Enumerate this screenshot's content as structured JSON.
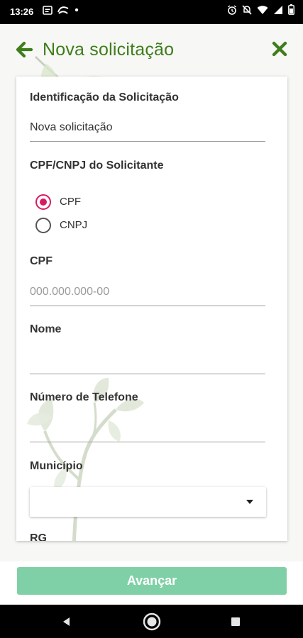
{
  "status_bar": {
    "time": "13:26",
    "left_icons": [
      "calendar-icon",
      "swirl-icon",
      "dot-icon"
    ],
    "right_icons": [
      "alarm-icon",
      "mute-icon",
      "wifi-icon",
      "signal-icon",
      "battery-icon"
    ]
  },
  "header": {
    "title": "Nova solicitação",
    "back_icon": "arrow-left-icon",
    "close_icon": "close-x-icon",
    "accent_color": "#3e7d1a"
  },
  "form": {
    "identificacao": {
      "label": "Identificação da Solicitação",
      "value": "Nova solicitação"
    },
    "cpf_cnpj": {
      "label": "CPF/CNPJ do Solicitante",
      "options": [
        {
          "label": "CPF",
          "checked": true
        },
        {
          "label": "CNPJ",
          "checked": false
        }
      ],
      "radio_color": "#d81b60"
    },
    "cpf": {
      "label": "CPF",
      "placeholder": "000.000.000-00",
      "value": ""
    },
    "nome": {
      "label": "Nome",
      "value": ""
    },
    "telefone": {
      "label": "Número de Telefone",
      "value": ""
    },
    "municipio": {
      "label": "Município",
      "selected": ""
    },
    "rg": {
      "label": "RG"
    }
  },
  "footer": {
    "advance_label": "Avançar",
    "advance_color": "#7fd0a6"
  },
  "nav_bar": {
    "buttons": [
      "back-triangle-icon",
      "home-circle-icon",
      "recents-square-icon"
    ]
  }
}
